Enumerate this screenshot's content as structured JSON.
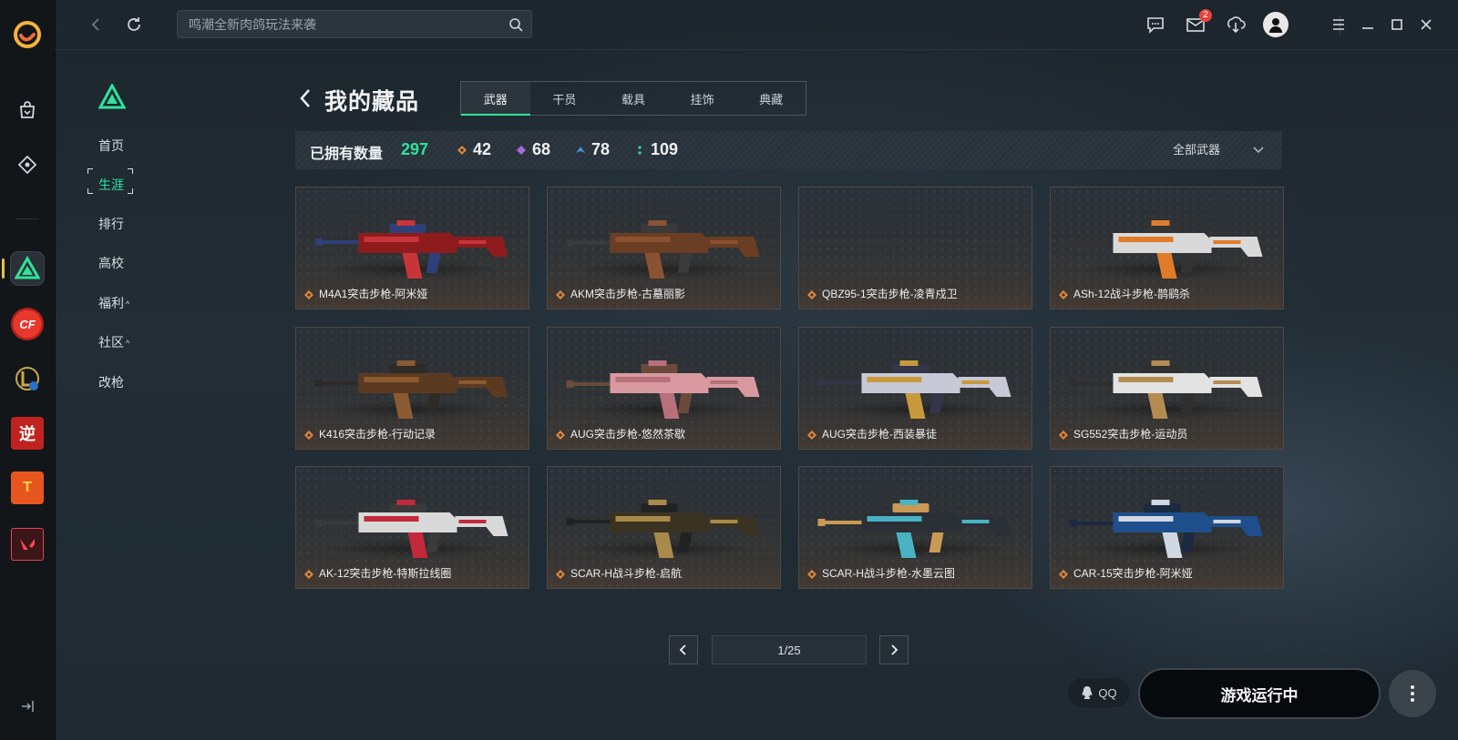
{
  "topbar": {
    "search_placeholder": "鸣潮全新肉鸽玩法来袭",
    "mail_badge": "2"
  },
  "sidebar": {
    "items": [
      {
        "label": "首页"
      },
      {
        "label": "生涯",
        "active": true
      },
      {
        "label": "排行"
      },
      {
        "label": "高校"
      },
      {
        "label": "福利",
        "caret": "^"
      },
      {
        "label": "社区",
        "caret": "^"
      },
      {
        "label": "改枪"
      }
    ]
  },
  "header": {
    "title": "我的藏品",
    "tabs": [
      "武器",
      "干员",
      "载具",
      "挂饰",
      "典藏"
    ],
    "active_tab": "武器"
  },
  "stats": {
    "owned_label": "已拥有数量",
    "owned_count": "297",
    "counts": [
      {
        "value": "42",
        "color": "#e0873a"
      },
      {
        "value": "68",
        "color": "#a66ad9"
      },
      {
        "value": "78",
        "color": "#4a8fd8"
      },
      {
        "value": "109",
        "color": "#3ccfb0"
      }
    ],
    "filter_label": "全部武器"
  },
  "items": [
    {
      "name": "M4A1突击步枪-阿米娅",
      "palette": [
        "#8e1c1c",
        "#c7353a",
        "#2e3f7a"
      ]
    },
    {
      "name": "AKM突击步枪-古墓丽影",
      "palette": [
        "#6b3e24",
        "#8a5233",
        "#3a3a3a"
      ]
    },
    {
      "name": "QBZ95-1突击步枪-凌青戍卫",
      "palette": null
    },
    {
      "name": "ASh-12战斗步枪-鹊鹞杀",
      "palette": [
        "#d9d9d9",
        "#e07b2a",
        "#333333"
      ]
    },
    {
      "name": "K416突击步枪-行动记录",
      "palette": [
        "#5c3a22",
        "#8b5a30",
        "#2e2a26"
      ]
    },
    {
      "name": "AUG突击步枪-悠然茶歇",
      "palette": [
        "#d89aa0",
        "#b8707a",
        "#6b4a3c"
      ]
    },
    {
      "name": "AUG突击步枪-西装暴徒",
      "palette": [
        "#c7c9d6",
        "#c89a3c",
        "#353549"
      ]
    },
    {
      "name": "SG552突击步枪-运动员",
      "palette": [
        "#e3e3e3",
        "#b48c52",
        "#2f2f2f"
      ]
    },
    {
      "name": "AK-12突击步枪-特斯拉线圈",
      "palette": [
        "#d9d9d9",
        "#c2293a",
        "#3a3a3a"
      ]
    },
    {
      "name": "SCAR-H战斗步枪-启航",
      "palette": [
        "#3b3322",
        "#a98a4a",
        "#222222"
      ]
    },
    {
      "name": "SCAR-H战斗步枪-水墨云图",
      "palette": [
        "#2b2f36",
        "#49b3c4",
        "#c89a54"
      ]
    },
    {
      "name": "CAR-15突击步枪-阿米娅",
      "palette": [
        "#1f4e8c",
        "#cfd8e3",
        "#1b2a40"
      ]
    }
  ],
  "pagination": {
    "text": "1/25"
  },
  "footer": {
    "qq_label": "QQ",
    "run_label": "游戏运行中"
  }
}
